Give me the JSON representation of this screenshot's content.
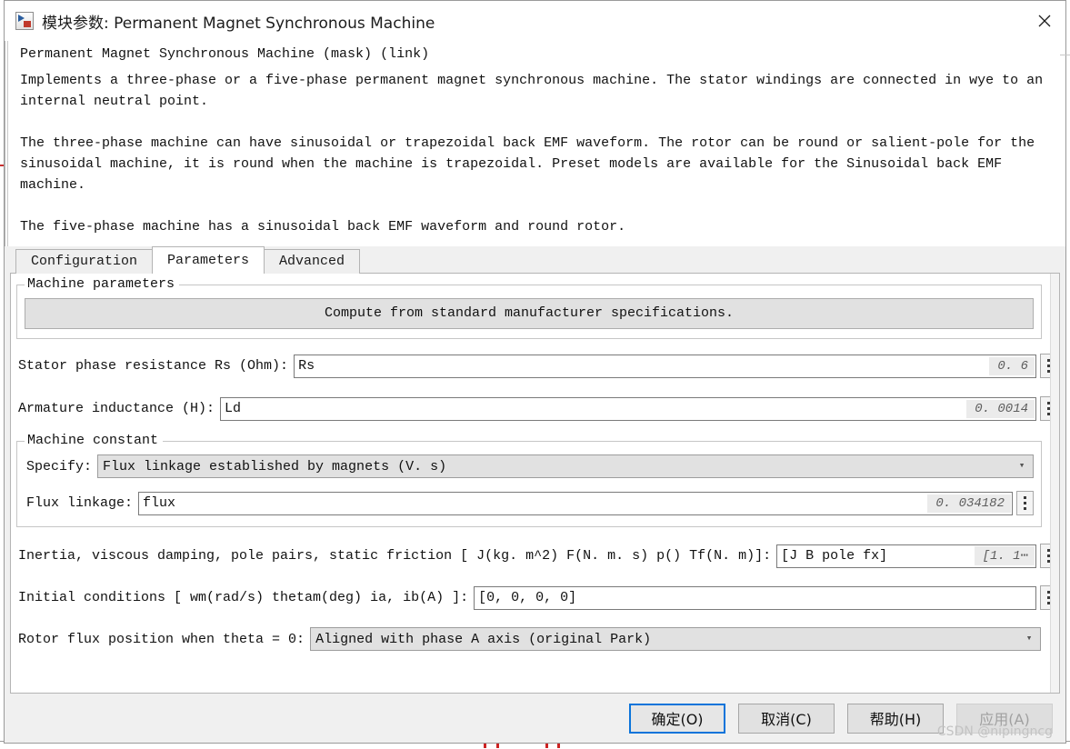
{
  "window": {
    "title": "模块参数: Permanent Magnet Synchronous Machine",
    "icon": "simulink-block-icon",
    "close_label": "✕"
  },
  "description": {
    "heading": "Permanent Magnet Synchronous Machine (mask) (link)",
    "paragraphs": [
      "Implements a three-phase or a five-phase permanent magnet synchronous machine. The stator windings are connected in wye to an internal neutral point.",
      "The three-phase machine can have sinusoidal or trapezoidal back EMF waveform. The rotor can be round or salient-pole for the sinusoidal machine, it is round when the machine is trapezoidal. Preset models are available for the Sinusoidal back EMF machine.",
      "The five-phase machine has a sinusoidal back EMF waveform and round rotor."
    ]
  },
  "tabs": [
    {
      "label": "Configuration",
      "active": false
    },
    {
      "label": "Parameters",
      "active": true
    },
    {
      "label": "Advanced",
      "active": false
    }
  ],
  "machine_parameters": {
    "group_title": "Machine parameters",
    "compute_button": "Compute from standard manufacturer specifications.",
    "rows": [
      {
        "label": "Stator phase resistance Rs (Ohm):",
        "value": "Rs",
        "hint": "0. 6"
      },
      {
        "label": "Armature inductance (H):",
        "value": "Ld",
        "hint": "0. 0014"
      }
    ]
  },
  "machine_constant": {
    "group_title": "Machine constant",
    "specify_label": "Specify:",
    "specify_value": "Flux linkage established by magnets (V. s)",
    "flux_label": "Flux linkage:",
    "flux_value": "flux",
    "flux_hint": "0. 034182"
  },
  "extra_rows": {
    "inertia": {
      "label": "Inertia, viscous damping, pole pairs, static friction [ J(kg. m^2)  F(N. m. s)  p()  Tf(N. m)]:",
      "value": "[J B pole fx]",
      "hint": "[1. 1⋯"
    },
    "initial": {
      "label": "Initial conditions  [ wm(rad/s)  thetam(deg)  ia, ib(A) ]:",
      "value": "[0, 0,  0, 0]"
    },
    "rotor_flux": {
      "label": "Rotor flux position when theta = 0:",
      "value": "Aligned with phase A axis (original Park)"
    }
  },
  "buttons": {
    "ok": "确定(O)",
    "cancel": "取消(C)",
    "help": "帮助(H)",
    "apply": "应用(A)"
  },
  "watermark": "CSDN @nipingncg",
  "colors": {
    "focus_border": "#0a74da",
    "dialog_bg": "#f0f0f0",
    "field_bg": "#ffffff",
    "combo_bg": "#e1e1e1",
    "hint_text": "#5e5e5e"
  }
}
